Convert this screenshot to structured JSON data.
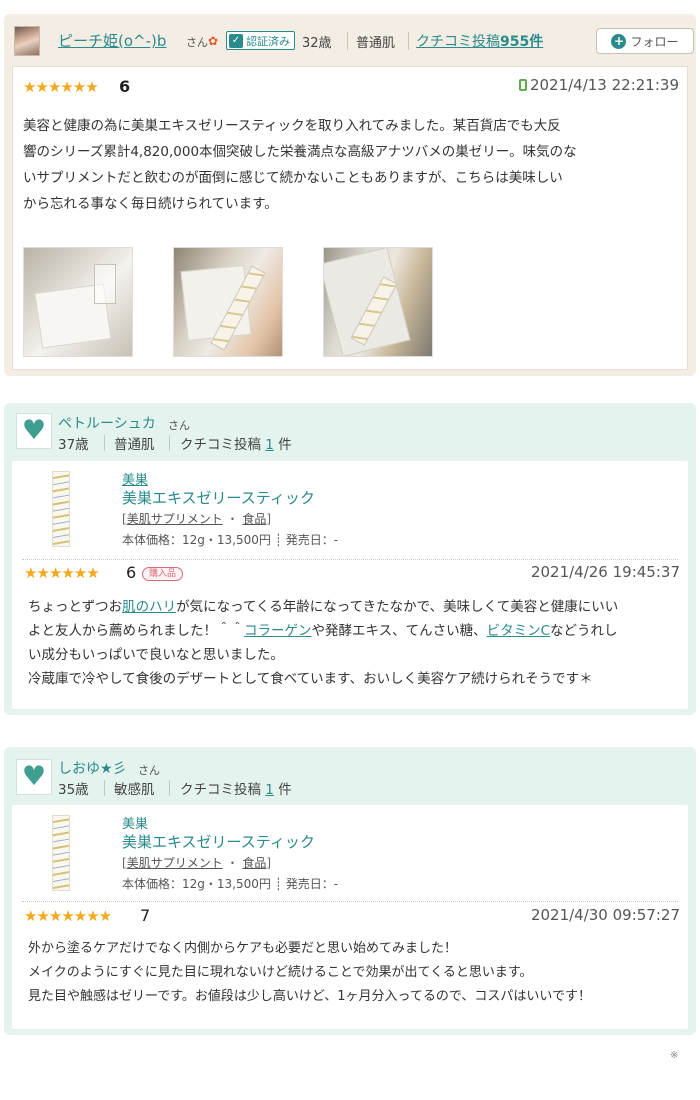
{
  "review1": {
    "user": {
      "name": "ピーチ姫(o^-)b",
      "san": "さん",
      "verified": "認証済み",
      "age": "32歳",
      "skin": "普通肌",
      "posts_label": "クチコミ投稿",
      "posts_count": "955件"
    },
    "follow_label": "フォロー",
    "stars": "★★★★★★",
    "score": "6",
    "date": "2021/4/13 22:21:39",
    "text": [
      "美容と健康の為に美巣エキスゼリースティックを取り入れてみました。某百貨店でも大反",
      "響のシリーズ累計4,820,000本個突破した栄養満点な高級アナツバメの巣ゼリー。味気のな",
      "いサプリメントだと飲むのが面倒に感じて続かないこともありますが、こちらは美味しい",
      "から忘れる事なく毎日続けられています。"
    ]
  },
  "review2": {
    "user": {
      "name": "ペトルーシュカ",
      "san": "さん",
      "age": "37歳",
      "skin": "普通肌",
      "posts_label": "クチコミ投稿",
      "posts_count": "1",
      "posts_unit": "件"
    },
    "product": {
      "brand": "美巣",
      "name": "美巣エキスゼリースティック",
      "cat1": "美肌サプリメント",
      "cat_sep": "・",
      "cat2": "食品",
      "price": "本体価格：12g・13,500円",
      "release": "発売日：-"
    },
    "stars": "★★★★★★",
    "score": "6",
    "purchased": "購入品",
    "date": "2021/4/26 19:45:37",
    "text": {
      "l1a": "ちょっとずつお",
      "l1k": "肌のハリ",
      "l1b": "が気になってくる年齢になってきたなかで、美味しくて美容と健康にいい",
      "l2a": "よと友人から薦められました！＾＾",
      "l2k": "コラーゲン",
      "l2b": "や発酵エキス、てんさい糖、",
      "l2k2": "ビタミンC",
      "l2c": "などうれし",
      "l3": "い成分もいっぱいで良いなと思いました。",
      "l4": "冷蔵庫で冷やして食後のデザートとして食べています、おいしく美容ケア続けられそうです＊"
    }
  },
  "review3": {
    "user": {
      "name": "しおゆ★彡",
      "san": "さん",
      "age": "35歳",
      "skin": "敏感肌",
      "posts_label": "クチコミ投稿",
      "posts_count": "1",
      "posts_unit": "件"
    },
    "product": {
      "brand": "美巣",
      "name": "美巣エキスゼリースティック",
      "cat1": "美肌サプリメント",
      "cat_sep": "・",
      "cat2": "食品",
      "price": "本体価格：12g・13,500円",
      "release": "発売日：-"
    },
    "stars": "★★★★★★★",
    "score": "7",
    "date": "2021/4/30 09:57:27",
    "text": [
      "外から塗るケアだけでなく内側からケアも必要だと思い始めてみました！",
      "メイクのようにすぐに見た目に現れないけど続けることで効果が出てくると思います。",
      "見た目や触感はゼリーです。お値段は少し高いけど、1ヶ月分入ってるので、コスパはいいです！"
    ]
  },
  "footnote": "※",
  "colors": {
    "accent": "#2a8a8c",
    "star": "#f2a81f",
    "card_beige": "#f3ede4",
    "card_mint": "#e5f3ee"
  }
}
